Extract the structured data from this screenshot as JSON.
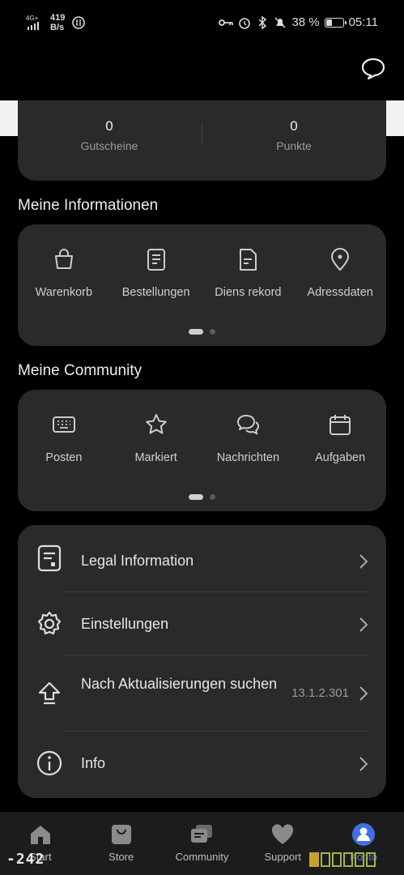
{
  "status": {
    "network": "4G+",
    "speed_value": "419",
    "speed_unit": "B/s",
    "battery": "38 %",
    "battery_level": 0.38,
    "time": "05:11"
  },
  "stats": [
    {
      "value": "0",
      "label": "Gutscheine"
    },
    {
      "value": "0",
      "label": "Punkte"
    }
  ],
  "info": {
    "title": "Meine Informationen",
    "items": [
      {
        "label": "Warenkorb",
        "icon": "bag-icon"
      },
      {
        "label": "Bestellungen",
        "icon": "order-list-icon"
      },
      {
        "label": "Diens rekord",
        "icon": "document-icon"
      },
      {
        "label": "Adressdaten",
        "icon": "location-pin-icon"
      }
    ]
  },
  "community": {
    "title": "Meine Community",
    "items": [
      {
        "label": "Posten",
        "icon": "keyboard-icon"
      },
      {
        "label": "Markiert",
        "icon": "star-icon"
      },
      {
        "label": "Nachrichten",
        "icon": "chat-bubbles-icon"
      },
      {
        "label": "Aufgaben",
        "icon": "calendar-icon"
      }
    ]
  },
  "settings_list": [
    {
      "label": "Legal Information",
      "icon": "legal-doc-icon",
      "value": ""
    },
    {
      "label": "Einstellungen",
      "icon": "gear-icon",
      "value": ""
    },
    {
      "label": "Nach Aktualisierungen suchen",
      "icon": "update-arrow-icon",
      "value": "13.1.2.301"
    },
    {
      "label": "Info",
      "icon": "info-icon",
      "value": ""
    }
  ],
  "tabs": [
    {
      "label": "Start",
      "icon": "home-icon",
      "active": false
    },
    {
      "label": "Store",
      "icon": "shopping-bag-icon",
      "active": false
    },
    {
      "label": "Community",
      "icon": "community-icon",
      "active": false
    },
    {
      "label": "Support",
      "icon": "heart-icon",
      "active": false
    },
    {
      "label": "Konto",
      "icon": "profile-icon",
      "active": true
    }
  ],
  "overlay": {
    "counter": "-242"
  },
  "colors": {
    "background": "#000000",
    "card": "#2a2a2a",
    "accent": "#3f6fe0"
  }
}
